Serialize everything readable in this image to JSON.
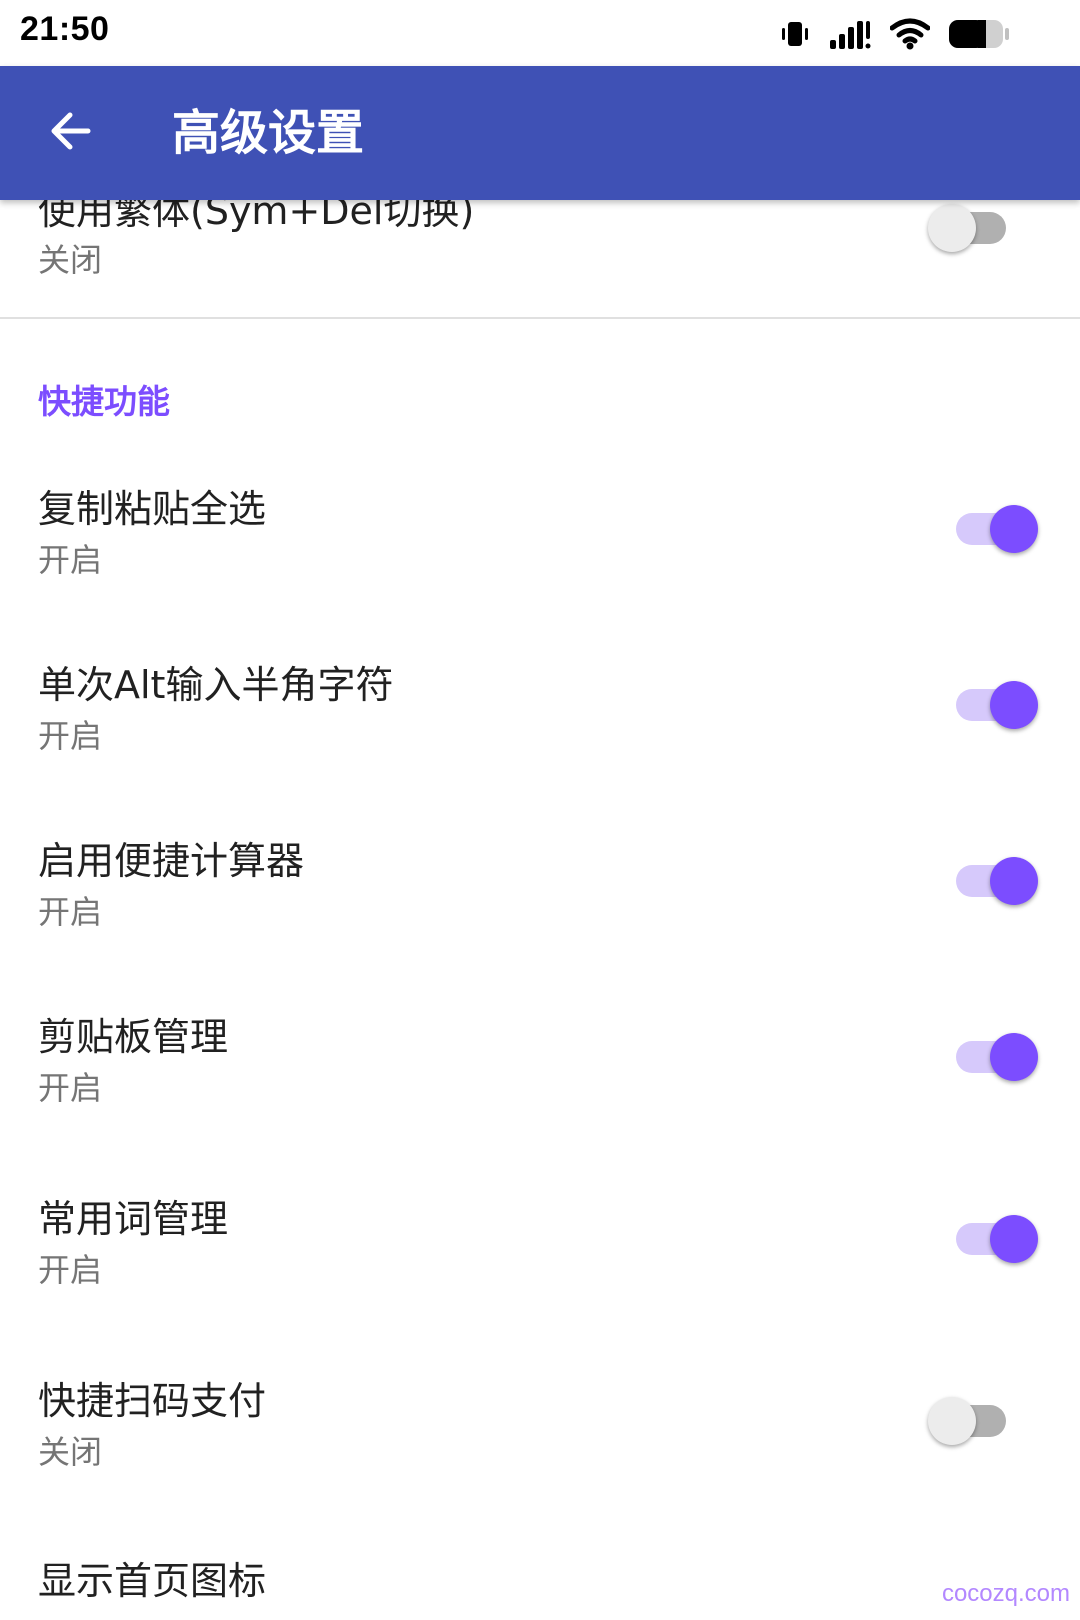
{
  "status_bar": {
    "time": "21:50",
    "icons": [
      "vibrate-icon",
      "signal-icon",
      "wifi-icon",
      "battery-icon"
    ]
  },
  "app_bar": {
    "back_icon": "arrow-back-icon",
    "title": "高级设置",
    "color": "#3f51b5"
  },
  "colors": {
    "accent": "#7c4dff",
    "switch_on_track": "#d6c9fb",
    "switch_off_track": "#b0b0b0",
    "divider": "#e0e0e0"
  },
  "previous_section": {
    "items": [
      {
        "title": "使用繁体(Sym+Del切换)",
        "summary": "关闭",
        "enabled": false
      }
    ]
  },
  "shortcuts_section": {
    "header": "快捷功能",
    "items": [
      {
        "title": "复制粘贴全选",
        "summary": "开启",
        "enabled": true
      },
      {
        "title": "单次Alt输入半角字符",
        "summary": "开启",
        "enabled": true
      },
      {
        "title": "启用便捷计算器",
        "summary": "开启",
        "enabled": true
      },
      {
        "title": "剪贴板管理",
        "summary": "开启",
        "enabled": true
      },
      {
        "title": "常用词管理",
        "summary": "开启",
        "enabled": true
      },
      {
        "title": "快捷扫码支付",
        "summary": "关闭",
        "enabled": false
      },
      {
        "title": "显示首页图标",
        "summary": "",
        "enabled": null
      }
    ]
  },
  "watermark": "cocozq.com"
}
